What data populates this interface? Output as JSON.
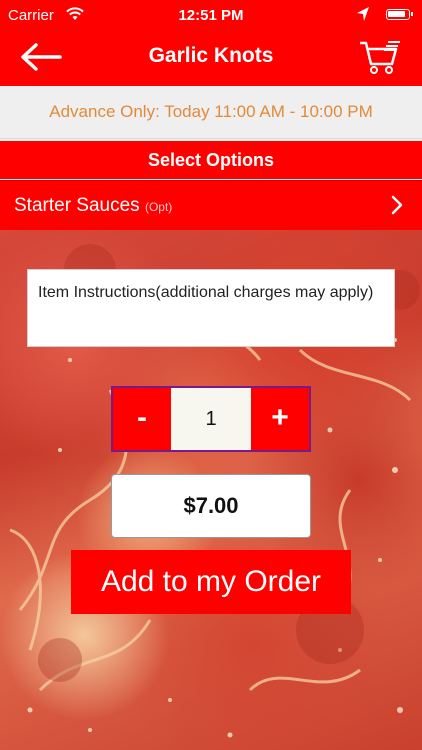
{
  "status_bar": {
    "carrier": "Carrier",
    "time": "12:51 PM"
  },
  "nav": {
    "title": "Garlic Knots"
  },
  "banner": {
    "text": "Advance Only: Today 11:00 AM - 10:00 PM"
  },
  "options": {
    "header": "Select Options",
    "items": [
      {
        "label": "Starter Sauces",
        "tag": "(Opt)"
      }
    ]
  },
  "instructions": {
    "placeholder": "Item Instructions(additional charges may apply)"
  },
  "quantity": {
    "minus_label": "-",
    "value": "1",
    "plus_label": "+"
  },
  "price": {
    "value": "$7.00"
  },
  "add_button": {
    "label": "Add to my Order"
  },
  "colors": {
    "brand_red": "#ff0000",
    "banner_text": "#e28a3a"
  }
}
